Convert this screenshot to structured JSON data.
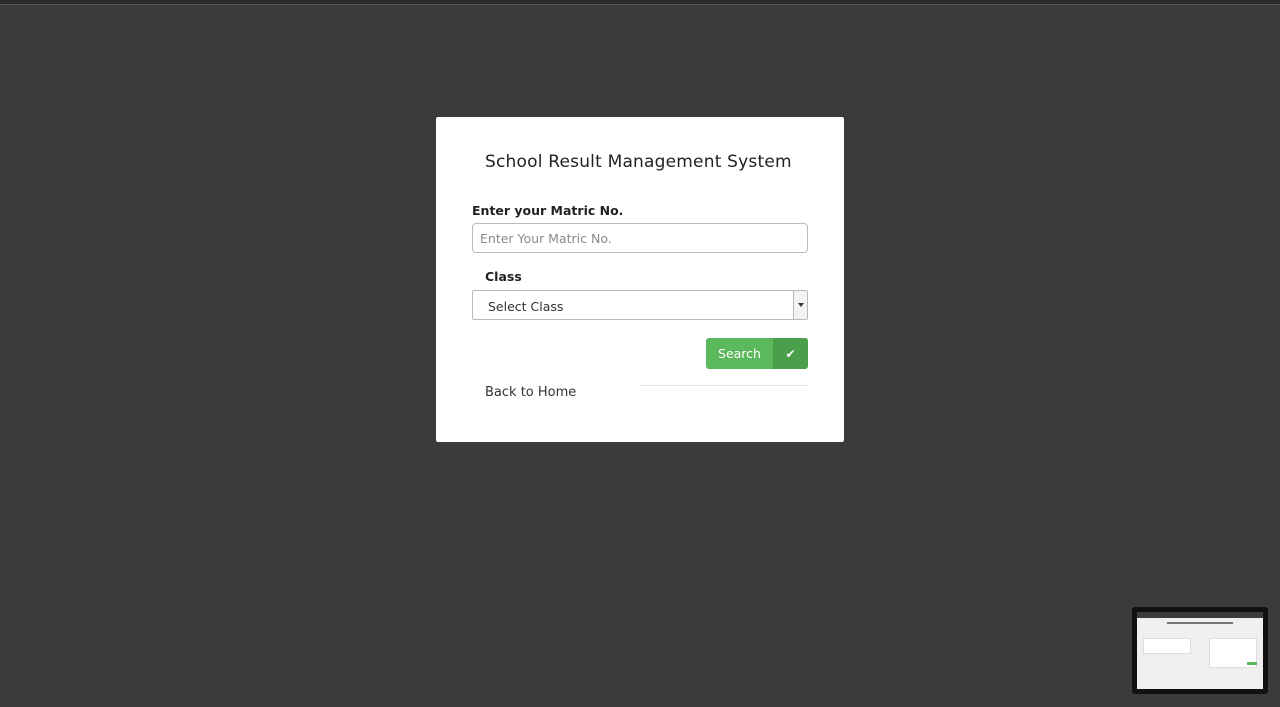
{
  "form": {
    "title": "School Result Management System",
    "matric_label": "Enter your Matric No.",
    "matric_placeholder": "Enter Your Matric No.",
    "matric_value": "",
    "class_label": "Class",
    "class_selected": "Select Class",
    "search_label": "Search",
    "back_link": "Back to Home"
  },
  "colors": {
    "background": "#3b3b3b",
    "card": "#ffffff",
    "button": "#5cb85c",
    "button_icon_bg": "#4a9f4a"
  },
  "icons": {
    "search_button_icon": "check-icon",
    "select_icon": "caret-down-icon"
  }
}
